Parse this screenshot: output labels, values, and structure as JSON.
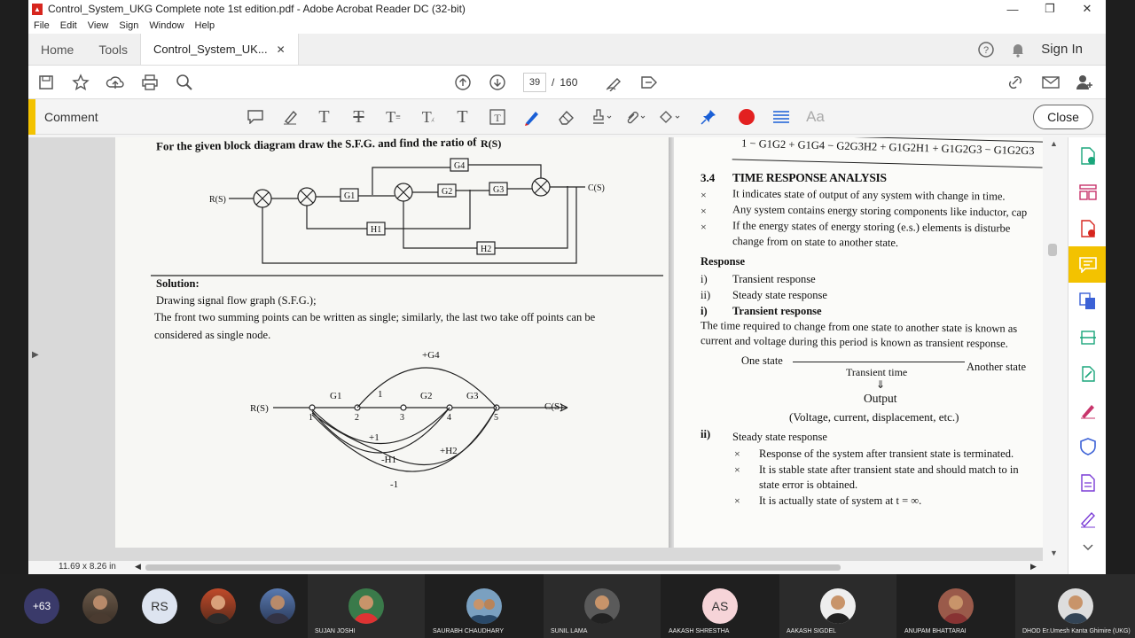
{
  "window": {
    "title": "Control_System_UKG Complete note 1st edition.pdf - Adobe Acrobat Reader DC (32-bit)",
    "minimize": "—",
    "restore": "❐",
    "close": "✕"
  },
  "menu": [
    "File",
    "Edit",
    "View",
    "Sign",
    "Window",
    "Help"
  ],
  "tabs": {
    "home": "Home",
    "tools": "Tools",
    "document": "Control_System_UK...",
    "close": "✕",
    "signin": "Sign In"
  },
  "toolbar": {
    "page_current": "39",
    "page_sep": "/",
    "page_total": "160"
  },
  "comment": {
    "label": "Comment",
    "close": "Close",
    "text_tool": "Aa"
  },
  "status": {
    "page_size": "11.69 x 8.26 in"
  },
  "left_page": {
    "question": "For the given block diagram draw the S.F.G. and find the ratio of",
    "ratio": "R(S)",
    "bd": {
      "input": "R(S)",
      "output": "C(S)",
      "g1": "G1",
      "g2": "G2",
      "g3": "G3",
      "g4": "G4",
      "h1": "H1",
      "h2": "H2"
    },
    "solution": "Solution:",
    "line1": "Drawing signal flow graph (S.F.G.);",
    "line2": "The front two summing points can be written as single; similarly, the last two take off points can be",
    "line3": "considered as single node.",
    "sfg": {
      "input": "R(S)",
      "output": "C(S)",
      "n1": "1",
      "n2": "2",
      "n3": "3",
      "n4": "4",
      "n5": "5",
      "g1": "G1",
      "one": "1",
      "g2": "G2",
      "g3": "G3",
      "g4": "+G4",
      "p1": "+1",
      "h2": "+H2",
      "mh1": "-H1",
      "m1": "-1"
    }
  },
  "right_page": {
    "top_formula": "1 − G1G2 + G1G4 − G2G3H2 + G1G2H1 + G1G2G3 − G1G2G3",
    "section_num": "3.4",
    "section_title": "TIME RESPONSE ANALYSIS",
    "bullets": [
      "It indicates state of output of any system with change in time.",
      "Any system contains energy storing components like inductor, cap",
      "If the energy states of energy storing (e.s.) elements is disturbe",
      "change from on state to another state."
    ],
    "response": "Response",
    "r1_num": "i)",
    "r1": "Transient response",
    "r2_num": "ii)",
    "r2": "Steady state response",
    "r3_num": "i)",
    "r3": "Transient response",
    "para1": "The time required to change from one state to another state is known as",
    "para2": "current and voltage during this period is known as transient response.",
    "one_state": "One state",
    "transient_time": "Transient time",
    "another_state": "Another state",
    "down_arrow": "⇓",
    "output": "Output",
    "output_detail": "(Voltage, current, displacement, etc.)",
    "ss_num": "ii)",
    "ss_title": "Steady state response",
    "ss_bullets": [
      "Response of the system after transient state is terminated.",
      "It is stable state after transient state and should match to in",
      "state error is obtained.",
      "It is actually state of system at t = ∞."
    ],
    "bullet_mark": "×"
  },
  "meeting": {
    "more": "+63",
    "rs": "RS",
    "as": "AS",
    "names": [
      "SUJAN JOSHI",
      "SAURABH CHAUDHARY",
      "SUNIL LAMA",
      "AAKASH SHRESTHA",
      "AAKASH SIGDEL",
      "ANUPAM BHATTARAI",
      "DHOD Er.Umesh Kanta Ghimire (UKG)"
    ]
  },
  "colors": {
    "accent_yellow": "#f3c200",
    "record_red": "#e32020",
    "annot_blue": "#1a5fd6",
    "meet_bg": "#1f1f1f"
  }
}
